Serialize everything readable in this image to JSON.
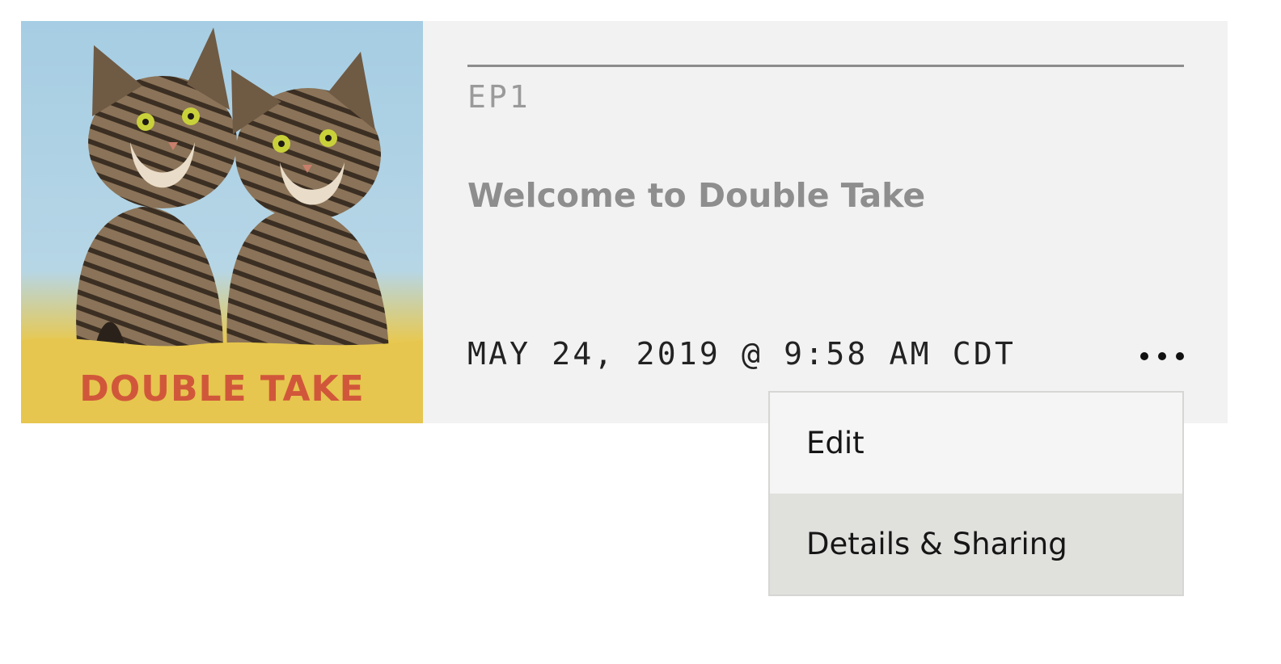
{
  "episode": {
    "artwork": {
      "title": "DOUBLE TAKE",
      "title_color": "#d1573b"
    },
    "number": "EP1",
    "title": "Welcome to Double Take",
    "published": "MAY 24, 2019 @ 9:58 AM CDT",
    "more_icon": "more-horizontal-icon"
  },
  "menu": {
    "items": [
      {
        "label": "Edit"
      },
      {
        "label": "Details & Sharing",
        "highlighted": true
      }
    ]
  },
  "colors": {
    "card_background": "#f2f2f2",
    "menu_background": "#f5f5f5",
    "menu_hover": "#e0e0dd"
  }
}
